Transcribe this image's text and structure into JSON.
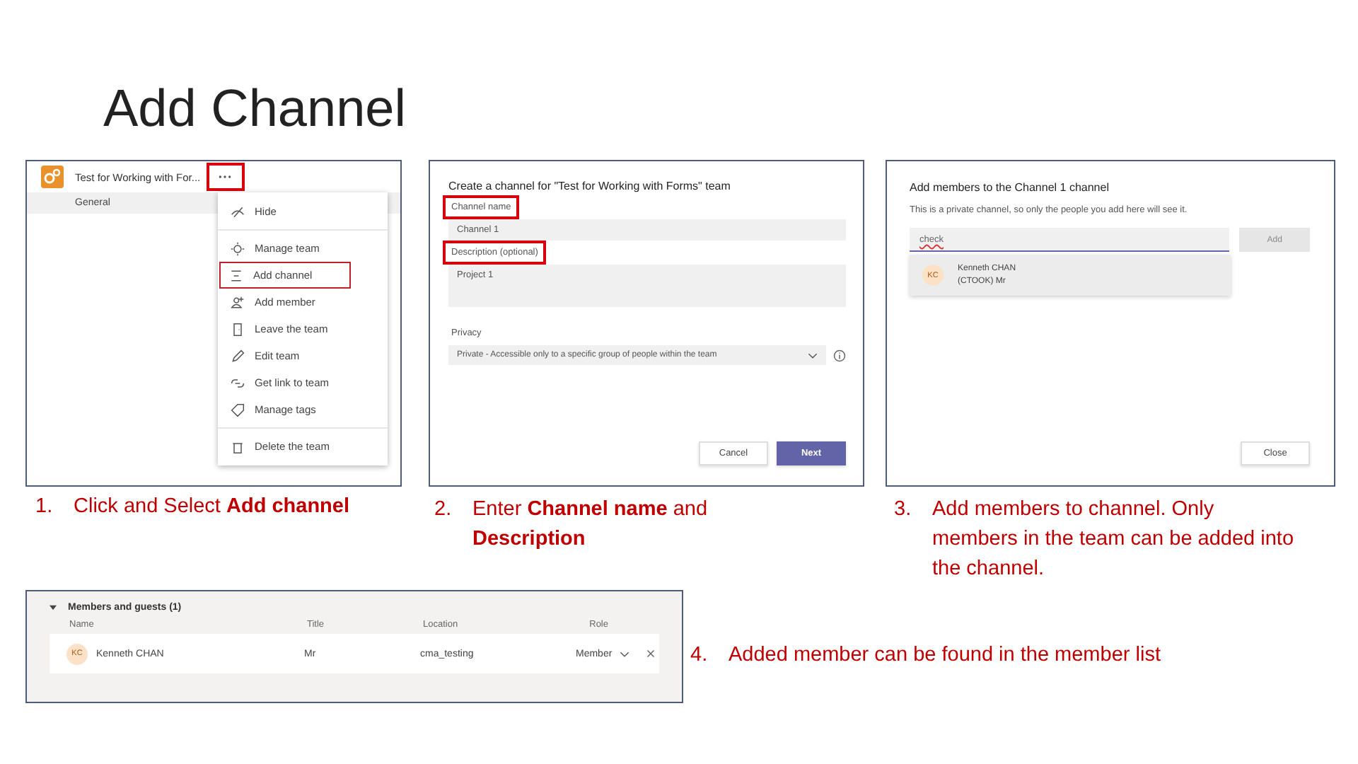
{
  "title": "Add Channel",
  "team_panel": {
    "team_name": "Test for Working with For...",
    "more_highlighted": true,
    "channel": "General",
    "menu_groups": [
      [
        {
          "label": "Hide",
          "highlighted": false
        }
      ],
      [
        {
          "label": "Manage team",
          "highlighted": false
        },
        {
          "label": "Add channel",
          "highlighted": true
        },
        {
          "label": "Add member",
          "highlighted": false
        },
        {
          "label": "Leave the team",
          "highlighted": false
        },
        {
          "label": "Edit team",
          "highlighted": false
        },
        {
          "label": "Get link to team",
          "highlighted": false
        },
        {
          "label": "Manage tags",
          "highlighted": false
        }
      ],
      [
        {
          "label": "Delete the team",
          "highlighted": false
        }
      ]
    ]
  },
  "create_panel": {
    "heading": "Create a channel for \"Test for Working with Forms\" team",
    "fields": [
      {
        "kind": "text",
        "label": "Channel name",
        "value": "Channel 1",
        "highlighted": true
      },
      {
        "kind": "textarea",
        "label": "Description (optional)",
        "value": "Project 1",
        "highlighted": true
      },
      {
        "kind": "select",
        "label": "Privacy",
        "value": "Private - Accessible only to a specific group of people within the team",
        "highlighted": false
      }
    ],
    "buttons": [
      {
        "label": "Cancel",
        "primary": false
      },
      {
        "label": "Next",
        "primary": true
      }
    ]
  },
  "members_panel": {
    "heading": "Add members to the Channel 1 channel",
    "note": "This is a private channel, so only the people you add here will see it.",
    "search": "check",
    "add_button": {
      "label": "Add",
      "disabled": true
    },
    "suggestion": {
      "initials": "KC",
      "name": "Kenneth CHAN",
      "detail": "(CTOOK) Mr"
    },
    "close_button": "Close"
  },
  "list_panel": {
    "section": "Members and guests (1)",
    "columns": [
      "Name",
      "Title",
      "Location",
      "Role"
    ],
    "rows": [
      {
        "initials": "KC",
        "name": "Kenneth CHAN",
        "title": "Mr",
        "location": "cma_testing",
        "role": "Member"
      }
    ]
  },
  "captions": [
    {
      "number": "1.",
      "text": "Click and Select **Add channel**"
    },
    {
      "number": "2.",
      "text": "Enter **Channel name** and **Description**"
    },
    {
      "number": "3.",
      "text": "Add members to channel. Only members in the team can be added into the channel."
    },
    {
      "number": "4.",
      "text": "Added member can be found in the member list"
    }
  ]
}
